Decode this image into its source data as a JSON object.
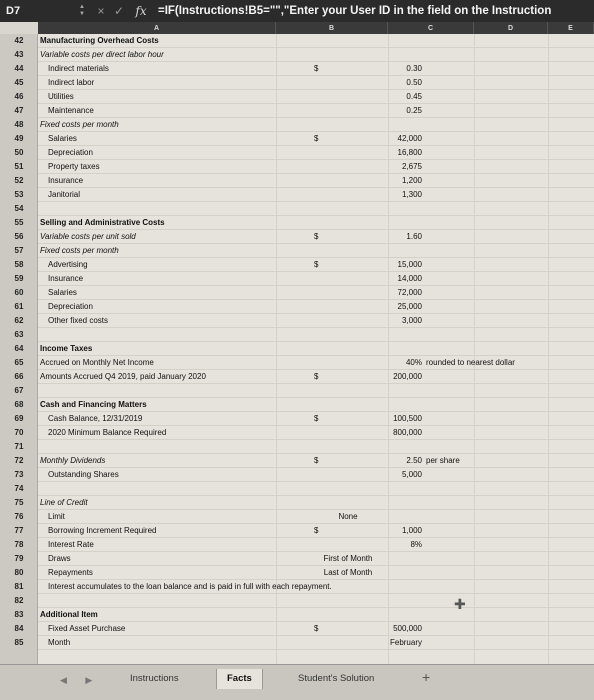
{
  "formula_bar": {
    "name_box": "D7",
    "cancel_icon": "×",
    "confirm_icon": "✓",
    "fx_label": "fx",
    "formula": "=IF(Instructions!B5=\"\",\"Enter your User ID in the field on the Instruction"
  },
  "columns": [
    "A",
    "B",
    "C",
    "D",
    "E"
  ],
  "rows": [
    {
      "n": "42",
      "label": "Manufacturing Overhead Costs",
      "style": "b"
    },
    {
      "n": "43",
      "label": "Variable costs per direct labor hour",
      "style": "it"
    },
    {
      "n": "44",
      "label": "Indirect materials",
      "style": "ind",
      "dollar": "$",
      "value": "0.30"
    },
    {
      "n": "45",
      "label": "Indirect labor",
      "style": "ind",
      "value": "0.50"
    },
    {
      "n": "46",
      "label": "Utilities",
      "style": "ind",
      "value": "0.45"
    },
    {
      "n": "47",
      "label": "Maintenance",
      "style": "ind",
      "value": "0.25"
    },
    {
      "n": "48",
      "label": "Fixed costs per month",
      "style": "it"
    },
    {
      "n": "49",
      "label": "Salaries",
      "style": "ind",
      "dollar": "$",
      "value": "42,000"
    },
    {
      "n": "50",
      "label": "Depreciation",
      "style": "ind",
      "value": "16,800"
    },
    {
      "n": "51",
      "label": "Property taxes",
      "style": "ind",
      "value": "2,675"
    },
    {
      "n": "52",
      "label": "Insurance",
      "style": "ind",
      "value": "1,200"
    },
    {
      "n": "53",
      "label": "Janitorial",
      "style": "ind",
      "value": "1,300"
    },
    {
      "n": "54",
      "label": ""
    },
    {
      "n": "55",
      "label": "Selling and Administrative Costs",
      "style": "b"
    },
    {
      "n": "56",
      "label": "Variable costs per unit sold",
      "style": "it",
      "dollar": "$",
      "value": "1.60"
    },
    {
      "n": "57",
      "label": "Fixed costs per month",
      "style": "it"
    },
    {
      "n": "58",
      "label": "Advertising",
      "style": "ind",
      "dollar": "$",
      "value": "15,000"
    },
    {
      "n": "59",
      "label": "Insurance",
      "style": "ind",
      "value": "14,000"
    },
    {
      "n": "60",
      "label": "Salaries",
      "style": "ind",
      "value": "72,000"
    },
    {
      "n": "61",
      "label": "Depreciation",
      "style": "ind",
      "value": "25,000"
    },
    {
      "n": "62",
      "label": "Other fixed costs",
      "style": "ind",
      "value": "3,000"
    },
    {
      "n": "63",
      "label": ""
    },
    {
      "n": "64",
      "label": "Income Taxes",
      "style": "b"
    },
    {
      "n": "65",
      "label": "Accrued on Monthly Net Income",
      "style": "",
      "value": "40%",
      "extra": "rounded to nearest dollar"
    },
    {
      "n": "66",
      "label": "Amounts Accrued Q4 2019, paid January 2020",
      "style": "",
      "dollar": "$",
      "value": "200,000"
    },
    {
      "n": "67",
      "label": ""
    },
    {
      "n": "68",
      "label": "Cash and Financing Matters",
      "style": "b"
    },
    {
      "n": "69",
      "label": "Cash Balance, 12/31/2019",
      "style": "ind",
      "dollar": "$",
      "value": "100,500"
    },
    {
      "n": "70",
      "label": "2020 Minimum Balance Required",
      "style": "ind",
      "value": "800,000"
    },
    {
      "n": "71",
      "label": ""
    },
    {
      "n": "72",
      "label": "Monthly Dividends",
      "style": "it",
      "dollar": "$",
      "value": "2.50",
      "extra": "per share"
    },
    {
      "n": "73",
      "label": "Outstanding Shares",
      "style": "ind",
      "value": "5,000"
    },
    {
      "n": "74",
      "label": ""
    },
    {
      "n": "75",
      "label": "Line of Credit",
      "style": "it"
    },
    {
      "n": "76",
      "label": "Limit",
      "style": "ind",
      "center": "None"
    },
    {
      "n": "77",
      "label": "Borrowing Increment Required",
      "style": "ind",
      "dollar": "$",
      "value": "1,000"
    },
    {
      "n": "78",
      "label": "Interest Rate",
      "style": "ind",
      "value": "8%"
    },
    {
      "n": "79",
      "label": "Draws",
      "style": "ind",
      "center": "First of Month"
    },
    {
      "n": "80",
      "label": "Repayments",
      "style": "ind",
      "center": "Last of Month"
    },
    {
      "n": "81",
      "label": "Interest accumulates to the loan balance and is paid in full with each repayment.",
      "style": "ind"
    },
    {
      "n": "82",
      "label": ""
    },
    {
      "n": "83",
      "label": "Additional Item",
      "style": "b"
    },
    {
      "n": "84",
      "label": "Fixed Asset Purchase",
      "style": "ind",
      "dollar": "$",
      "value": "500,000"
    },
    {
      "n": "85",
      "label": "Month",
      "style": "ind",
      "value": "February"
    }
  ],
  "tabs": {
    "nav": "◀ ▶",
    "items": [
      "Instructions",
      "Facts",
      "Student's Solution"
    ],
    "active_index": 1,
    "add": "+"
  }
}
